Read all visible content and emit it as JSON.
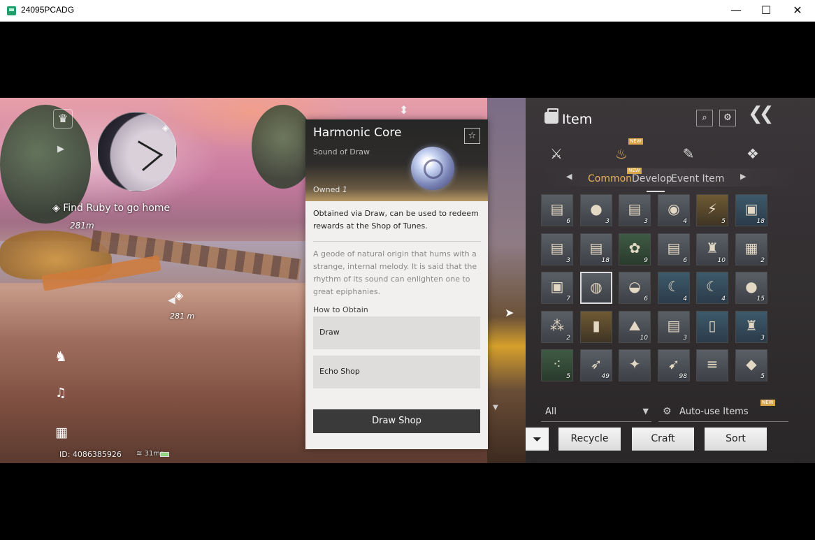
{
  "window": {
    "title": "24095PCADG",
    "minimize_glyph": "—",
    "maximize_glyph": "☐",
    "close_glyph": "✕"
  },
  "hud": {
    "quest_text": "Find Ruby to go home",
    "quest_distance": "281m",
    "waypoint_distance": "281 m",
    "player_id": "ID: 4086385926",
    "ping": "31ms",
    "icons": [
      "crown-map-icon",
      "quest-marker-icon",
      "horse-icon",
      "ear-icon",
      "grid-menu-icon"
    ]
  },
  "detail": {
    "name": "Harmonic Core",
    "subtitle": "Sound of Draw",
    "owned_label": "Owned",
    "owned_count": "1",
    "favorite_glyph": "☆",
    "obtain_summary": "Obtained via Draw, can be used to redeem rewards at the Shop of Tunes.",
    "lore": "A geode of natural origin that hums with a strange, internal melody. It is said that the rhythm of its sound can enlighten one to great epiphanies.",
    "how_to_obtain_label": "How to Obtain",
    "obtain_sources": [
      "Draw",
      "Echo Shop"
    ],
    "draw_shop_button": "Draw Shop"
  },
  "inventory": {
    "title": "Item",
    "new_badge": "NEW",
    "category_tabs": [
      {
        "icon": "crossed-swords-icon",
        "glyph": "⚔"
      },
      {
        "icon": "pouch-icon",
        "glyph": "♨"
      },
      {
        "icon": "scroll-icon",
        "glyph": "✎"
      },
      {
        "icon": "stone-icon",
        "glyph": "❖"
      }
    ],
    "subtabs": [
      "Common",
      "Develop",
      "Event Item"
    ],
    "grid": [
      {
        "icon": "scroll-icon",
        "glyph": "▤",
        "count": "6",
        "tier": ""
      },
      {
        "icon": "bun-plate-icon",
        "glyph": "●",
        "count": "3",
        "tier": ""
      },
      {
        "icon": "scroll-icon",
        "glyph": "▤",
        "count": "3",
        "tier": ""
      },
      {
        "icon": "orb-stand-icon",
        "glyph": "◉",
        "count": "4",
        "tier": ""
      },
      {
        "icon": "lightning-icon",
        "glyph": "⚡",
        "count": "5",
        "tier": "epic"
      },
      {
        "icon": "chest-icon",
        "glyph": "▣",
        "count": "18",
        "tier": "rare"
      },
      {
        "icon": "scroll-icon",
        "glyph": "▤",
        "count": "3",
        "tier": ""
      },
      {
        "icon": "scroll-icon",
        "glyph": "▤",
        "count": "18",
        "tier": ""
      },
      {
        "icon": "blossom-icon",
        "glyph": "✿",
        "count": "9",
        "tier": "green"
      },
      {
        "icon": "scroll-icon",
        "glyph": "▤",
        "count": "6",
        "tier": ""
      },
      {
        "icon": "sack-icon",
        "glyph": "♜",
        "count": "10",
        "tier": ""
      },
      {
        "icon": "crate-icon",
        "glyph": "▦",
        "count": "2",
        "tier": ""
      },
      {
        "icon": "chest-icon",
        "glyph": "▣",
        "count": "7",
        "tier": ""
      },
      {
        "icon": "harmonic-core-icon",
        "glyph": "◍",
        "count": "",
        "tier": "selected"
      },
      {
        "icon": "bowl-icon",
        "glyph": "◒",
        "count": "6",
        "tier": ""
      },
      {
        "icon": "horn-icon",
        "glyph": "☾",
        "count": "4",
        "tier": "rare"
      },
      {
        "icon": "horn-icon",
        "glyph": "☾",
        "count": "4",
        "tier": "rare"
      },
      {
        "icon": "bun-plate-icon",
        "glyph": "●",
        "count": "15",
        "tier": ""
      },
      {
        "icon": "eggs-icon",
        "glyph": "⁂",
        "count": "2",
        "tier": ""
      },
      {
        "icon": "talisman-icon",
        "glyph": "▮",
        "count": "",
        "tier": "epic"
      },
      {
        "icon": "mountain-coin-icon",
        "glyph": "⛰",
        "count": "10",
        "tier": ""
      },
      {
        "icon": "scroll-icon",
        "glyph": "▤",
        "count": "3",
        "tier": ""
      },
      {
        "icon": "red-ticket-icon",
        "glyph": "▯",
        "count": "",
        "tier": "rare"
      },
      {
        "icon": "sack-icon",
        "glyph": "♜",
        "count": "3",
        "tier": "rare"
      },
      {
        "icon": "seeds-icon",
        "glyph": "⁖",
        "count": "5",
        "tier": "green"
      },
      {
        "icon": "arrow-icon",
        "glyph": "➶",
        "count": "49",
        "tier": ""
      },
      {
        "icon": "pelt-icon",
        "glyph": "✦",
        "count": "",
        "tier": ""
      },
      {
        "icon": "spear-icon",
        "glyph": "➹",
        "count": "98",
        "tier": ""
      },
      {
        "icon": "wood-icon",
        "glyph": "≡",
        "count": "",
        "tier": ""
      },
      {
        "icon": "ore-icon",
        "glyph": "◆",
        "count": "5",
        "tier": ""
      }
    ],
    "filter_value": "All",
    "autouse_label": "Auto-use Items",
    "buttons": {
      "recycle": "Recycle",
      "craft": "Craft",
      "sort": "Sort"
    }
  }
}
